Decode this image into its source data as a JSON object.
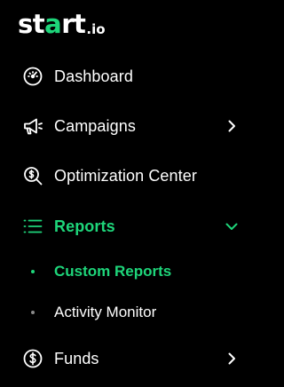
{
  "brand": {
    "logo_prefix": "st",
    "logo_accent": "a",
    "logo_suffix": "rt",
    "logo_tld": ".io"
  },
  "colors": {
    "background": "#000000",
    "text": "#ffffff",
    "accent": "#1ed57a",
    "inactive_dot": "#8a8a8a"
  },
  "nav": {
    "items": [
      {
        "label": "Dashboard",
        "icon": "speedometer-icon",
        "expandable": false,
        "active": false
      },
      {
        "label": "Campaigns",
        "icon": "megaphone-icon",
        "expandable": true,
        "expanded": false,
        "active": false
      },
      {
        "label": "Optimization Center",
        "icon": "search-dollar-icon",
        "expandable": false,
        "active": false
      },
      {
        "label": "Reports",
        "icon": "list-icon",
        "expandable": true,
        "expanded": true,
        "active": true,
        "children": [
          {
            "label": "Custom Reports",
            "active": true
          },
          {
            "label": "Activity Monitor",
            "active": false
          }
        ]
      },
      {
        "label": "Funds",
        "icon": "dollar-circle-icon",
        "expandable": true,
        "expanded": false,
        "active": false
      }
    ]
  }
}
